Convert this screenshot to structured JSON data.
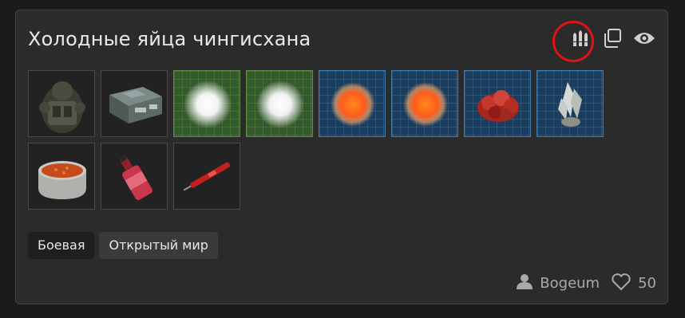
{
  "card": {
    "title": "Холодные яйца чингисхана",
    "author": "Bogeum",
    "likes": "50",
    "tags": [
      "Боевая",
      "Открытый мир"
    ]
  },
  "icons": {
    "ammo": "ammo-icon",
    "copy": "copy-icon",
    "view": "eye-icon",
    "user": "user-icon",
    "like": "heart-icon"
  },
  "items": [
    {
      "name": "armor-suit",
      "rarity": "common"
    },
    {
      "name": "container",
      "rarity": "common"
    },
    {
      "name": "white-artifact",
      "rarity": "green"
    },
    {
      "name": "white-artifact",
      "rarity": "green"
    },
    {
      "name": "orange-artifact",
      "rarity": "blue"
    },
    {
      "name": "orange-artifact",
      "rarity": "blue"
    },
    {
      "name": "red-coral-artifact",
      "rarity": "blue"
    },
    {
      "name": "crystal-artifact",
      "rarity": "blue"
    },
    {
      "name": "stew-pot",
      "rarity": "common"
    },
    {
      "name": "red-bottle",
      "rarity": "common"
    },
    {
      "name": "red-syringe",
      "rarity": "common"
    }
  ],
  "colors": {
    "highlight": "#e31212",
    "green_rarity": "#345a2b",
    "blue_rarity": "#1b3d5e"
  }
}
